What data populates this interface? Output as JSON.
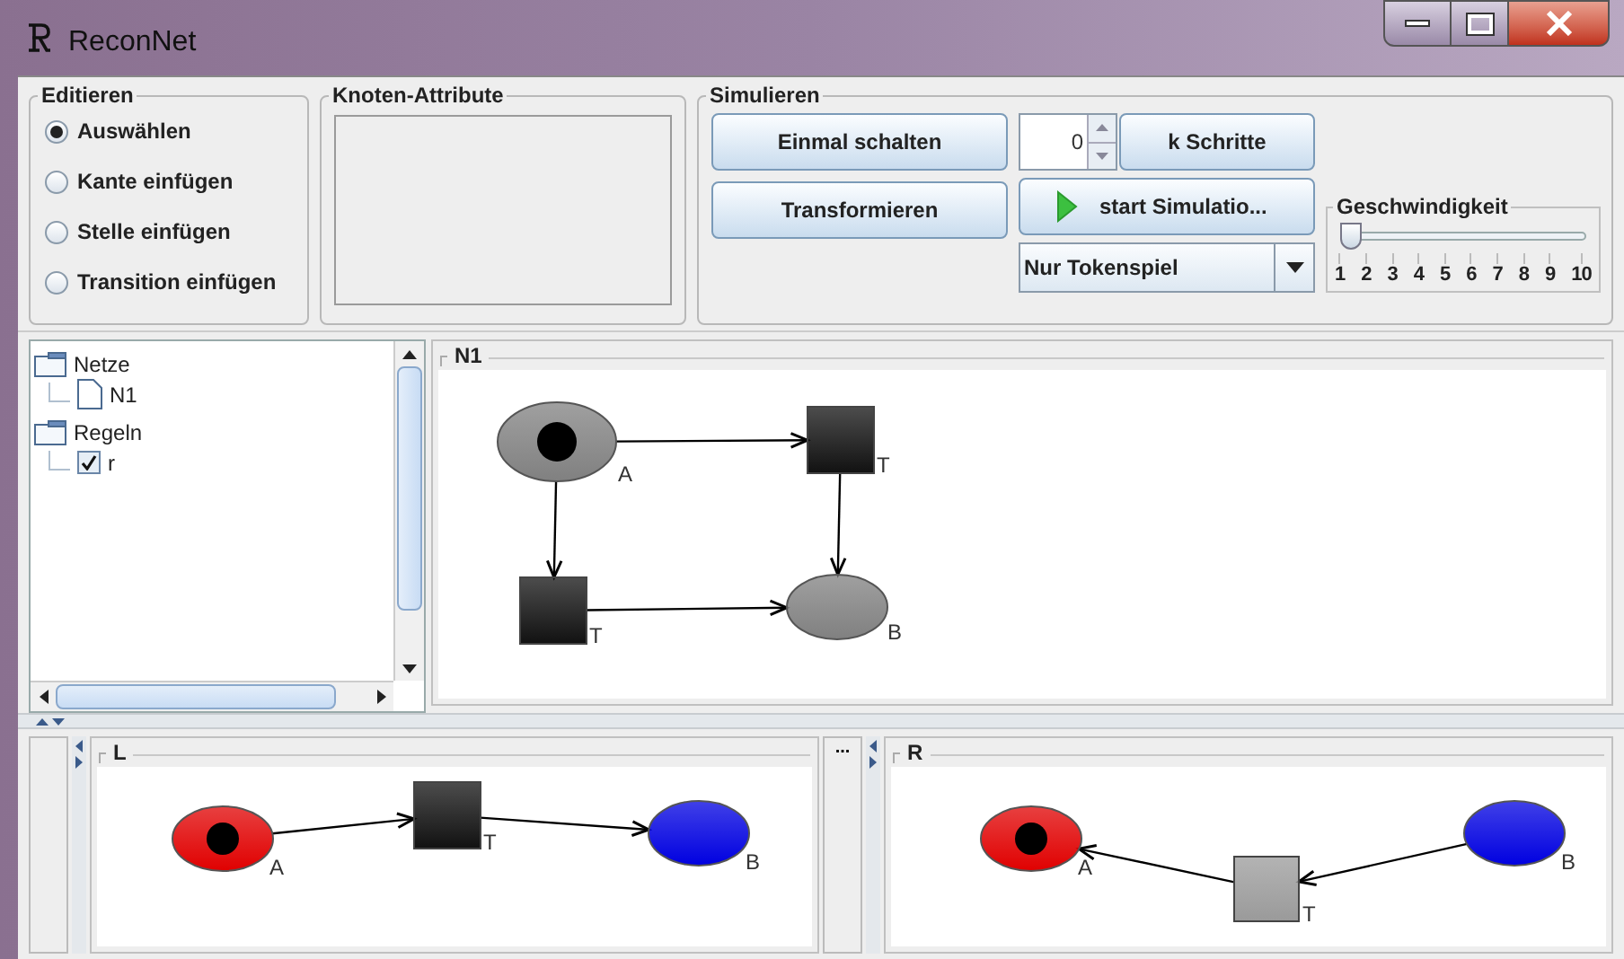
{
  "window": {
    "title": "ReconNet"
  },
  "editieren": {
    "title": "Editieren",
    "options": [
      {
        "label": "Auswählen",
        "selected": true
      },
      {
        "label": "Kante einfügen",
        "selected": false
      },
      {
        "label": "Stelle einfügen",
        "selected": false
      },
      {
        "label": "Transition einfügen",
        "selected": false
      }
    ]
  },
  "knoten_attribute": {
    "title": "Knoten-Attribute"
  },
  "simulieren": {
    "title": "Simulieren",
    "buttons": [
      "Einmal schalten",
      "Transformieren"
    ],
    "steps": {
      "value": "0"
    },
    "k_button": "k Schritte",
    "start_button": "start Simulatio...",
    "mode": {
      "value": "Nur Tokenspiel"
    },
    "speed": {
      "title": "Geschwindigkeit",
      "level": 0,
      "ticks": [
        "1",
        "2",
        "3",
        "4",
        "5",
        "6",
        "7",
        "8",
        "9",
        "10"
      ]
    }
  },
  "tree": {
    "items": [
      {
        "label": "Netze",
        "kind": "folder",
        "children": [
          {
            "label": "N1",
            "kind": "file"
          }
        ]
      },
      {
        "label": "Regeln",
        "kind": "folder",
        "children": [
          {
            "label": "r",
            "kind": "check",
            "checked": true
          }
        ]
      }
    ]
  },
  "main_net": {
    "title": "N1",
    "nodes": [
      {
        "kind": "place",
        "label": "A",
        "marked": true,
        "color": "#808080"
      },
      {
        "kind": "transition",
        "label": "T",
        "color": "#111111"
      },
      {
        "kind": "transition",
        "label": "T",
        "color": "#111111"
      },
      {
        "kind": "place",
        "label": "B",
        "marked": false,
        "color": "#808080"
      }
    ]
  },
  "rule": {
    "collapsed_label": "...",
    "panels": [
      {
        "title": "L",
        "nodes": [
          {
            "kind": "place",
            "label": "A",
            "marked": true,
            "color": "#e00000"
          },
          {
            "kind": "transition",
            "label": "T",
            "color": "#111111"
          },
          {
            "kind": "place",
            "label": "B",
            "marked": false,
            "color": "#0000e0"
          }
        ]
      },
      {
        "title": "R",
        "nodes": [
          {
            "kind": "place",
            "label": "A",
            "marked": true,
            "color": "#e00000"
          },
          {
            "kind": "transition",
            "label": "T",
            "color": "#9a9a9a"
          },
          {
            "kind": "place",
            "label": "B",
            "marked": false,
            "color": "#0000e0"
          }
        ]
      }
    ]
  }
}
